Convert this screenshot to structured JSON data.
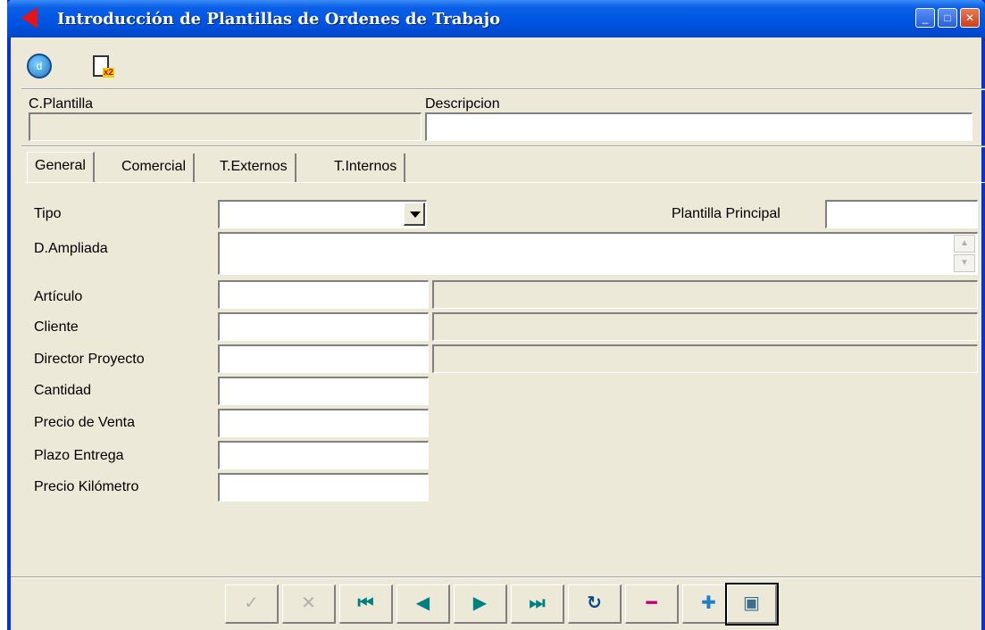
{
  "window": {
    "title": "Introducción de Plantillas de Ordenes de Trabajo"
  },
  "toolbar": {
    "btn1_icon": "d",
    "btn2_badge": "x2"
  },
  "header": {
    "cplantilla_label": "C.Plantilla",
    "descripcion_label": "Descripcion",
    "cplantilla_value": "",
    "descripcion_value": ""
  },
  "tabs": [
    "General",
    "Comercial",
    "T.Externos",
    "T.Internos"
  ],
  "form": {
    "tipo_label": "Tipo",
    "plantilla_principal_label": "Plantilla Principal",
    "d_ampliada_label": "D.Ampliada",
    "articulo_label": "Artículo",
    "cliente_label": "Cliente",
    "director_label": "Director Proyecto",
    "cantidad_label": "Cantidad",
    "precio_venta_label": "Precio de Venta",
    "plazo_label": "Plazo Entrega",
    "precio_km_label": "Precio Kilómetro"
  },
  "nav": {
    "confirm": "✓",
    "cancel": "✕",
    "first": "⏮",
    "prev": "◀",
    "next": "▶",
    "last": "⏭",
    "refresh": "↻",
    "delete": "━",
    "add": "✚",
    "exit": "▣"
  },
  "colors": {
    "titlebar": "#0054e3",
    "face": "#ece9d8",
    "delete": "#c0007a",
    "add": "#1e7ec8",
    "nav_blue": "#008080"
  }
}
